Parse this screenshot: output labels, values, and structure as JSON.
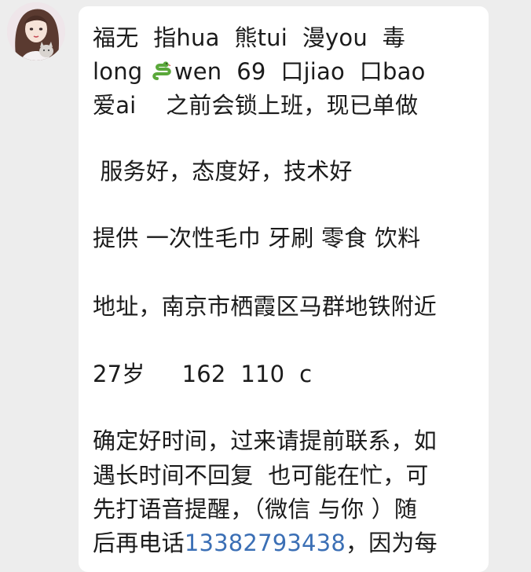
{
  "chat": {
    "avatar_icon": "avatar-girl-with-cat",
    "message_lines": [
      {
        "text": "福无  指hua  熊tui  漫you  毒"
      },
      {
        "pre": "long ",
        "icon": "snake-emoji",
        "post": "wen  69  口jiao  口bao"
      },
      {
        "text": "爱ai    之前会锁上班，现已单做"
      },
      {
        "text": " 服务好，态度好，技术好"
      },
      {
        "text": "提供 一次性毛巾 牙刷 零食 饮料"
      },
      {
        "text": "地址，南京市栖霞区马群地铁附近"
      },
      {
        "text": "27岁     162  110  c"
      },
      {
        "text": "确定好时间，过来请提前联系，如"
      },
      {
        "text": "遇长时间不回复  也可能在忙，可"
      },
      {
        "text": "先打语音提醒，（微信 与你 ）随"
      },
      {
        "pre": "后再电话",
        "phone": "13382793438",
        "post": "，因为每"
      }
    ]
  },
  "colors": {
    "background": "#ededed",
    "bubble": "#ffffff",
    "text": "#1b1b1b",
    "link": "#3b6fb5"
  }
}
